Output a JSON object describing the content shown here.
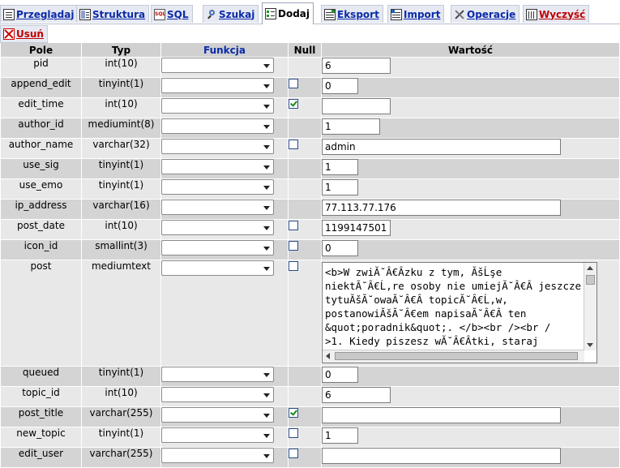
{
  "tabs": [
    {
      "label": "Przeglądaj",
      "icon": "browse-icon"
    },
    {
      "label": "Struktura",
      "icon": "structure-icon"
    },
    {
      "label": "SQL",
      "icon": "sql-icon"
    },
    {
      "label": "Szukaj",
      "icon": "search-icon"
    },
    {
      "label": "Dodaj",
      "icon": "insert-icon",
      "active": true
    },
    {
      "label": "Eksport",
      "icon": "export-icon"
    },
    {
      "label": "Import",
      "icon": "import-icon"
    },
    {
      "label": "Operacje",
      "icon": "operations-icon"
    },
    {
      "label": "Wyczyść",
      "icon": "empty-table-icon"
    },
    {
      "label": "Usuń",
      "icon": "drop-table-icon"
    }
  ],
  "columns": {
    "field": "Pole",
    "type": "Typ",
    "function": "Funkcja",
    "null": "Null",
    "value": "Wartość"
  },
  "rows": [
    {
      "name": "pid",
      "type": "int(10)",
      "nullable": false,
      "null_checked": false,
      "value": "6",
      "value_width": 85
    },
    {
      "name": "append_edit",
      "type": "tinyint(1)",
      "nullable": true,
      "null_checked": false,
      "value": "0",
      "value_width": 45
    },
    {
      "name": "edit_time",
      "type": "int(10)",
      "nullable": true,
      "null_checked": true,
      "value": "",
      "value_width": 85
    },
    {
      "name": "author_id",
      "type": "mediumint(8)",
      "nullable": false,
      "null_checked": false,
      "value": "1",
      "value_width": 72
    },
    {
      "name": "author_name",
      "type": "varchar(32)",
      "nullable": true,
      "null_checked": false,
      "value": "admin",
      "value_width": 295
    },
    {
      "name": "use_sig",
      "type": "tinyint(1)",
      "nullable": false,
      "null_checked": false,
      "value": "1",
      "value_width": 45
    },
    {
      "name": "use_emo",
      "type": "tinyint(1)",
      "nullable": false,
      "null_checked": false,
      "value": "1",
      "value_width": 45
    },
    {
      "name": "ip_address",
      "type": "varchar(16)",
      "nullable": false,
      "null_checked": false,
      "value": "77.113.77.176",
      "value_width": 295
    },
    {
      "name": "post_date",
      "type": "int(10)",
      "nullable": true,
      "null_checked": false,
      "value": "1199147501",
      "value_width": 85
    },
    {
      "name": "icon_id",
      "type": "smallint(3)",
      "nullable": true,
      "null_checked": false,
      "value": "0",
      "value_width": 45
    },
    {
      "name": "post",
      "type": "mediumtext",
      "nullable": true,
      "null_checked": false,
      "textarea": true,
      "value": "<b>W zwiĂ˘Â€Âzku z tym, ĂšĹşe\nniektĂ˘Â€Ĺ‚re osoby nie umiejĂ˘Â€Â jeszcze\ntytuĂšĂ˘owaĂ˘Â€Â topicĂ˘Â€Ĺ‚w,\npostanowiĂšĂ˘Â€em napisaĂ˘Â€Â ten\n&quot;poradnik&quot;. </b><br /><br /\n>1. Kiedy piszesz wĂ˘Â€Âtki, staraj"
    },
    {
      "name": "queued",
      "type": "tinyint(1)",
      "nullable": false,
      "null_checked": false,
      "value": "0",
      "value_width": 45
    },
    {
      "name": "topic_id",
      "type": "int(10)",
      "nullable": false,
      "null_checked": false,
      "value": "6",
      "value_width": 85
    },
    {
      "name": "post_title",
      "type": "varchar(255)",
      "nullable": true,
      "null_checked": true,
      "value": "",
      "value_width": 295
    },
    {
      "name": "new_topic",
      "type": "tinyint(1)",
      "nullable": true,
      "null_checked": false,
      "value": "1",
      "value_width": 45
    },
    {
      "name": "edit_user",
      "type": "varchar(255)",
      "nullable": true,
      "null_checked": false,
      "value": "",
      "value_width": 295
    }
  ]
}
